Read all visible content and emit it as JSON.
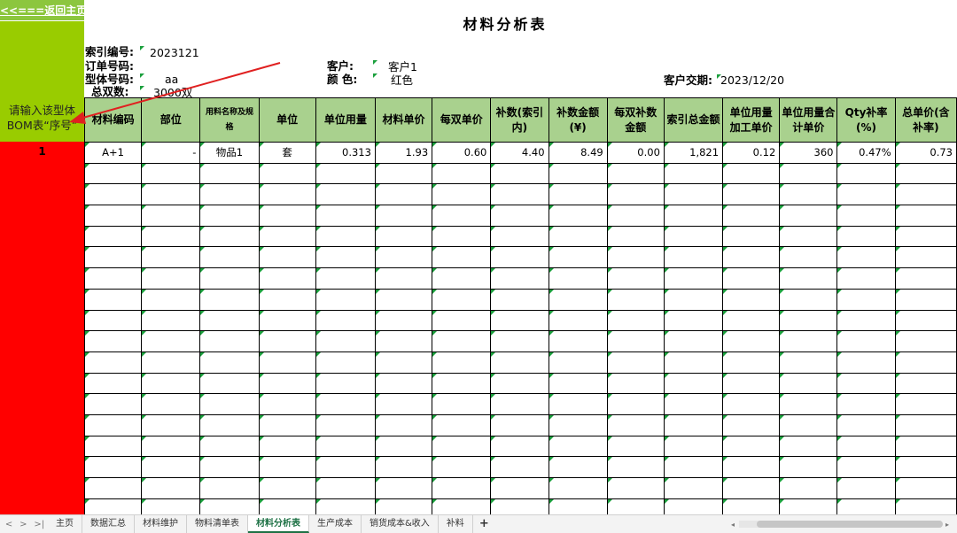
{
  "left_panel": {
    "back_label": "<<===返回主页",
    "instruction": "请输入该型体BOM表“序号”",
    "row_number": "1"
  },
  "title": "材料分析表",
  "info": {
    "index_no_label": "索引编号:",
    "index_no_value": "2023121",
    "order_no_label": "订单号码:",
    "order_no_value": "",
    "style_no_label": "型体号码:",
    "style_no_value": "aa",
    "total_pairs_label": "总双数:",
    "total_pairs_value": "3000双",
    "customer_label": "客户:",
    "customer_value": "客户1",
    "color_label": "颜 色:",
    "color_value": "红色",
    "delivery_label": "客户交期:",
    "delivery_value": "2023/12/20"
  },
  "table": {
    "headers": [
      "材料编码",
      "部位",
      "用料名称及规格",
      "单位",
      "单位用量",
      "材料单价",
      "每双单价",
      "补数(索引内)",
      "补数金额(¥)",
      "每双补数金额",
      "索引总金额",
      "单位用量加工单价",
      "单位用量合计单价",
      "Qty补率(%)",
      "总单价(含补率)"
    ],
    "rows": [
      [
        "A+1",
        "-",
        "物品1",
        "套",
        "0.313",
        "1.93",
        "0.60",
        "4.40",
        "8.49",
        "0.00",
        "1,821",
        "0.12",
        "360",
        "0.47%",
        "0.73"
      ]
    ]
  },
  "sheet_tabs": {
    "nav": [
      "<",
      ">",
      ">|"
    ],
    "tabs": [
      "主页",
      "数据汇总",
      "材料维护",
      "物料清单表",
      "材料分析表",
      "生产成本",
      "销货成本&收入",
      "补料"
    ],
    "active": "材料分析表",
    "add": "+"
  },
  "colors": {
    "header_bg": "#a9d18e",
    "instruction_bg": "#99cc00",
    "red_area": "#ff0000",
    "arrow": "#e02020",
    "active_tab": "#1e7145"
  }
}
